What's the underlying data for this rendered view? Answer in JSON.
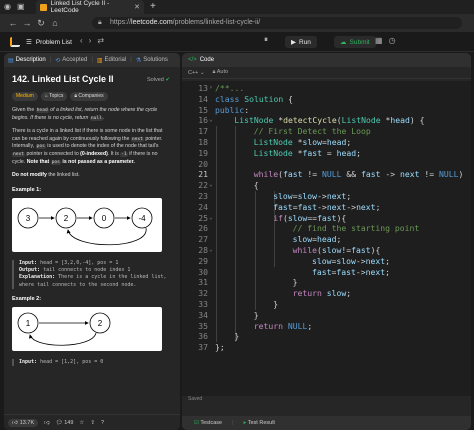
{
  "browser": {
    "tab_title": "Linked List Cycle II - LeetCode",
    "tab_close": "✕",
    "new_tab": "+",
    "url_host": "leetcode.com",
    "url_path": "/problems/linked-list-cycle-ii/",
    "url_prefix": "https://"
  },
  "lc_header": {
    "problem_list": "Problem List",
    "run_label": "Run",
    "submit_label": "Submit"
  },
  "left": {
    "tabs": [
      "Description",
      "Accepted",
      "Editorial",
      "Solutions"
    ],
    "title": "142. Linked List Cycle II",
    "solved": "Solved",
    "pills": [
      "Medium",
      "Topics",
      "Companies"
    ],
    "p1a": "Given the ",
    "p1code": "head",
    "p1b": " of a linked list, return the node where the cycle begins. If there is no cycle, return ",
    "p1null": "null",
    "p1c": ".",
    "p2": "There is a cycle in a linked list if there is some node in the list that can be reached again by continuously following the ",
    "p2code": "next",
    "p2b": " pointer. Internally, ",
    "p2pos": "pos",
    "p2c": " is used to denote the index of the node that tail's ",
    "p2next": "next",
    "p2d": " pointer is connected to ",
    "p2idx": "(0-indexed)",
    "p2e": ". It is ",
    "p2neg": "-1",
    "p2f": " if there is no cycle. ",
    "p2bold": "Note that",
    "p2pos2": "pos",
    "p2g": " is not passed as a parameter.",
    "p3": "Do not modify",
    "p3b": " the linked list.",
    "ex1_title": "Example 1:",
    "ex1_nodes": [
      "3",
      "2",
      "0",
      "-4"
    ],
    "ex1_input_label": "Input:",
    "ex1_input": " head = [3,2,0,-4], pos = 1",
    "ex1_output_label": "Output:",
    "ex1_output": " tail connects to node index 1",
    "ex1_expl_label": "Explanation:",
    "ex1_expl": " There is a cycle in the linked list, where tail connects to the second node.",
    "ex2_title": "Example 2:",
    "ex2_nodes": [
      "1",
      "2"
    ],
    "ex2_input_label": "Input:",
    "ex2_input": " head = [1,2], pos = 0",
    "likes": "13.7K",
    "comments": "149"
  },
  "right": {
    "code_tab": "Code",
    "lang": "C++",
    "auto": "Auto",
    "saved": "Saved",
    "testcase": "Testcase",
    "test_result": "Test Result",
    "lines": [
      {
        "n": "13",
        "text": "/**...",
        "indent": 0,
        "fold": ">"
      },
      {
        "n": "14",
        "text": "class Solution {",
        "indent": 0,
        "fold": ""
      },
      {
        "n": "15",
        "text": "public:",
        "indent": 0,
        "fold": ""
      },
      {
        "n": "16",
        "text": "ListNode *detectCycle(ListNode *head) {",
        "indent": 1,
        "fold": "v"
      },
      {
        "n": "17",
        "text": "// First Detect the Loop",
        "indent": 2,
        "fold": ""
      },
      {
        "n": "18",
        "text": "ListNode *slow=head;",
        "indent": 2,
        "fold": ""
      },
      {
        "n": "19",
        "text": "ListNode *fast = head;",
        "indent": 2,
        "fold": ""
      },
      {
        "n": "20",
        "text": "",
        "indent": 0,
        "fold": ""
      },
      {
        "n": "21",
        "text": "while(fast != NULL && fast -> next != NULL)",
        "indent": 2,
        "fold": ""
      },
      {
        "n": "22",
        "text": "{",
        "indent": 2,
        "fold": "v"
      },
      {
        "n": "23",
        "text": "slow=slow->next;",
        "indent": 3,
        "fold": ""
      },
      {
        "n": "24",
        "text": "fast=fast->next->next;",
        "indent": 3,
        "fold": ""
      },
      {
        "n": "25",
        "text": "if(slow==fast){",
        "indent": 3,
        "fold": "v"
      },
      {
        "n": "26",
        "text": "// find the starting point",
        "indent": 4,
        "fold": ""
      },
      {
        "n": "27",
        "text": "slow=head;",
        "indent": 4,
        "fold": ""
      },
      {
        "n": "28",
        "text": "while(slow!=fast){",
        "indent": 4,
        "fold": "v"
      },
      {
        "n": "29",
        "text": "slow=slow->next;",
        "indent": 5,
        "fold": ""
      },
      {
        "n": "30",
        "text": "fast=fast->next;",
        "indent": 5,
        "fold": ""
      },
      {
        "n": "31",
        "text": "}",
        "indent": 4,
        "fold": ""
      },
      {
        "n": "32",
        "text": "return slow;",
        "indent": 4,
        "fold": ""
      },
      {
        "n": "33",
        "text": "}",
        "indent": 3,
        "fold": ""
      },
      {
        "n": "34",
        "text": "}",
        "indent": 2,
        "fold": ""
      },
      {
        "n": "35",
        "text": "return NULL;",
        "indent": 2,
        "fold": ""
      },
      {
        "n": "36",
        "text": "}",
        "indent": 1,
        "fold": ""
      },
      {
        "n": "37",
        "text": "};",
        "indent": 0,
        "fold": ""
      }
    ],
    "current_line_label": "21"
  },
  "colors": {
    "accent_orange": "#ffa116",
    "submit_green": "#2db55d",
    "medium_yellow": "#ffb800"
  }
}
